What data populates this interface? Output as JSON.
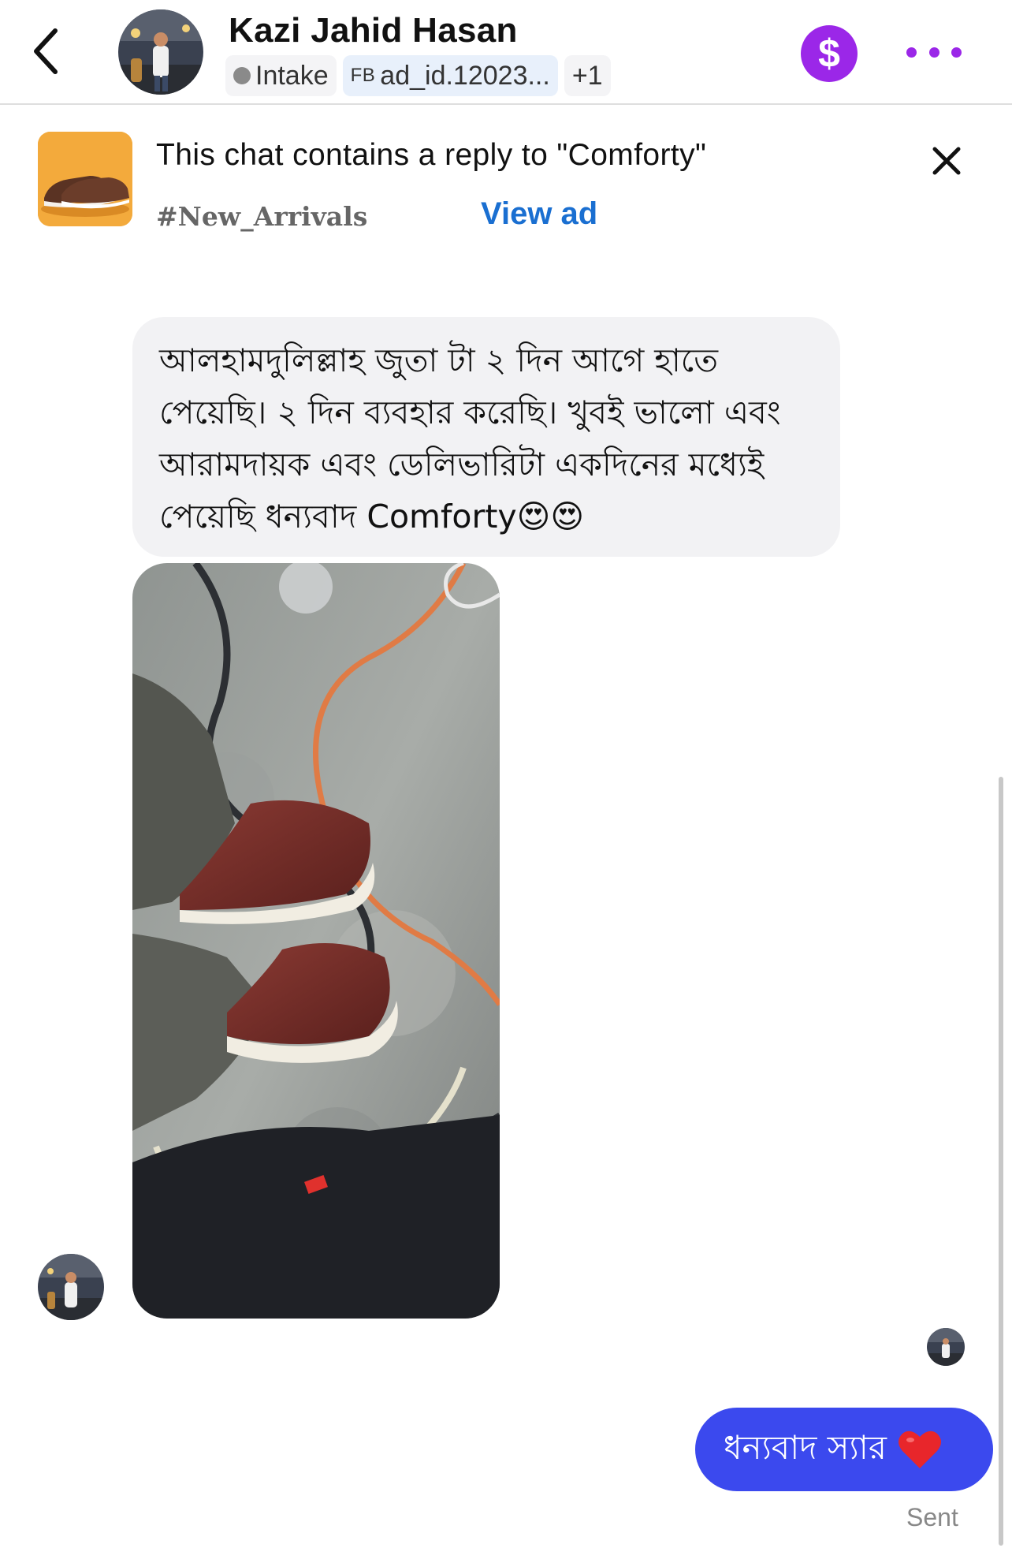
{
  "header": {
    "contact_name": "Kazi Jahid Hasan",
    "status_label": "Intake",
    "ad_chip_prefix": "FB",
    "ad_chip_label": "ad_id.12023...",
    "extra_count": "+1",
    "pay_symbol": "$",
    "colors": {
      "accent": "#9b27e8"
    }
  },
  "ad_banner": {
    "title": "This chat contains a reply to \"Comforty\"",
    "hashtag": "#New_Arrivals",
    "view_ad_label": "View ad"
  },
  "messages": {
    "received_text": "আলহামদুলিল্লাহ জুতা টা ২ দিন আগে হাতে পেয়েছি। ২ দিন  ব্যবহার করেছি। খুবই ভালো এবং আরামদায়ক এবং ডেলিভারিটা একদিনের মধ্যেই পেয়েছি ধন্যবাদ Comforty😍😍",
    "sent_text": "ধন্যবাদ স্যার",
    "sent_emoji": "❤️",
    "sent_status": "Sent",
    "colors": {
      "sent_bubble": "#3b49ee",
      "received_bubble": "#f2f2f4"
    }
  },
  "icons": [
    "back-icon",
    "status-dot-icon",
    "dollar-icon",
    "more-icon",
    "close-icon",
    "heart-emoji"
  ]
}
